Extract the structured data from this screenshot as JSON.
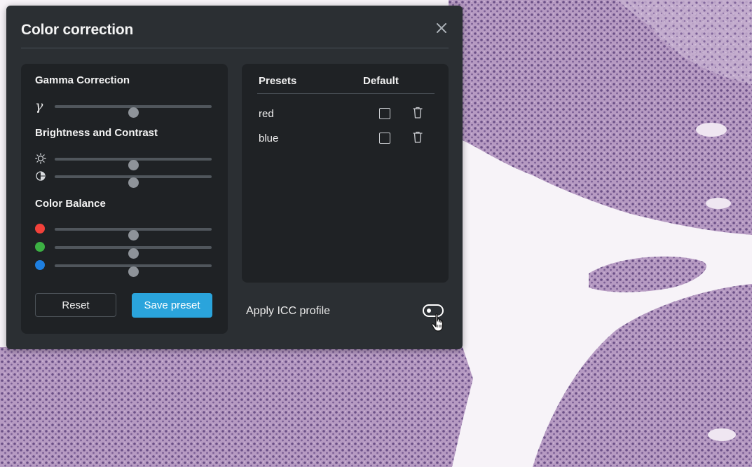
{
  "dialog": {
    "title": "Color correction",
    "close_icon": "close-icon"
  },
  "gamma": {
    "title": "Gamma Correction",
    "symbol": "γ",
    "value": 0.5
  },
  "brightness_contrast": {
    "title": "Brightness and Contrast",
    "brightness_icon": "sun-icon",
    "contrast_icon": "contrast-icon",
    "brightness_value": 0.5,
    "contrast_value": 0.5
  },
  "color_balance": {
    "title": "Color Balance",
    "channels": [
      {
        "name": "red",
        "color": "#f2413a",
        "value": 0.5
      },
      {
        "name": "green",
        "color": "#3cb043",
        "value": 0.5
      },
      {
        "name": "blue",
        "color": "#1e7fe0",
        "value": 0.5
      }
    ]
  },
  "buttons": {
    "reset": "Reset",
    "save_preset": "Save preset"
  },
  "presets": {
    "header_name": "Presets",
    "header_default": "Default",
    "items": [
      {
        "name": "red",
        "default": false
      },
      {
        "name": "blue",
        "default": false
      }
    ]
  },
  "icc": {
    "label": "Apply ICC profile",
    "enabled": false
  },
  "colors": {
    "accent": "#2aa4dc",
    "dialog_bg": "#2b2f33",
    "panel_bg": "#1f2225"
  }
}
